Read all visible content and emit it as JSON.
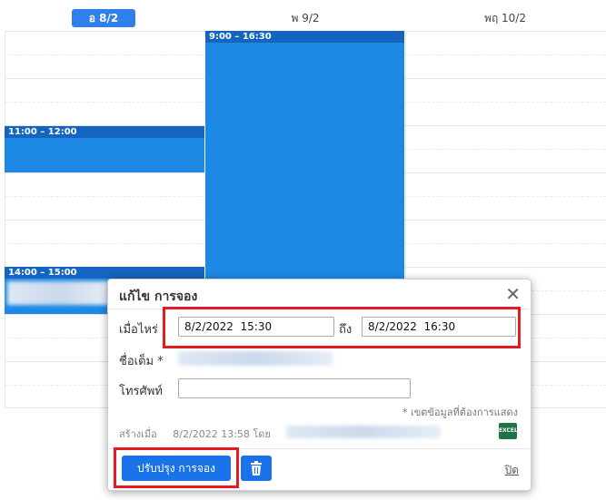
{
  "calendar": {
    "days": [
      {
        "label": "อ 8/2",
        "active": true
      },
      {
        "label": "พ 9/2",
        "active": false
      },
      {
        "label": "พฤ 10/2",
        "active": false
      }
    ],
    "events": [
      {
        "time": "9:00 – 16:30"
      },
      {
        "time": "11:00 – 12:00"
      },
      {
        "time": "14:00 – 15:00"
      }
    ]
  },
  "dialog": {
    "title": "แก้ไข การจอง",
    "when_label": "เมื่อไหร่",
    "start_value": "8/2/2022  15:30",
    "to_label": "ถึง",
    "end_value": "8/2/2022  16:30",
    "name_label": "ชื่อเต็ม *",
    "phone_label": "โทรศัพท์",
    "phone_value": "",
    "required_hint": "* เขตข้อมูลที่ต้องการแสดง",
    "created_label": "สร้างเมื่อ",
    "created_value": "8/2/2022 13:58 โดย",
    "excel_icon_text": "EXCEL",
    "update_button": "ปรับปรุง การจอง",
    "close_link": "ปิด"
  }
}
